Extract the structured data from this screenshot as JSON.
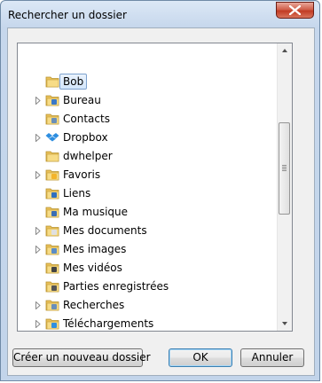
{
  "window": {
    "title": "Rechercher un dossier"
  },
  "tree": {
    "items": [
      {
        "label": "Bob",
        "expandable": false,
        "selected": true,
        "icon": "user-folder-icon"
      },
      {
        "label": "Bureau",
        "expandable": true,
        "selected": false,
        "icon": "desktop-folder-icon"
      },
      {
        "label": "Contacts",
        "expandable": false,
        "selected": false,
        "icon": "contacts-folder-icon"
      },
      {
        "label": "Dropbox",
        "expandable": true,
        "selected": false,
        "icon": "dropbox-icon"
      },
      {
        "label": "dwhelper",
        "expandable": false,
        "selected": false,
        "icon": "folder-icon"
      },
      {
        "label": "Favoris",
        "expandable": true,
        "selected": false,
        "icon": "favorites-folder-icon"
      },
      {
        "label": "Liens",
        "expandable": false,
        "selected": false,
        "icon": "links-folder-icon"
      },
      {
        "label": "Ma musique",
        "expandable": false,
        "selected": false,
        "icon": "music-folder-icon"
      },
      {
        "label": "Mes documents",
        "expandable": true,
        "selected": false,
        "icon": "documents-folder-icon"
      },
      {
        "label": "Mes images",
        "expandable": true,
        "selected": false,
        "icon": "pictures-folder-icon"
      },
      {
        "label": "Mes vidéos",
        "expandable": false,
        "selected": false,
        "icon": "videos-folder-icon"
      },
      {
        "label": "Parties enregistrées",
        "expandable": false,
        "selected": false,
        "icon": "saved-games-folder-icon"
      },
      {
        "label": "Recherches",
        "expandable": true,
        "selected": false,
        "icon": "searches-folder-icon"
      },
      {
        "label": "Téléchargements",
        "expandable": true,
        "selected": false,
        "icon": "downloads-folder-icon"
      }
    ]
  },
  "buttons": {
    "new_folder": "Créer un nouveau dossier",
    "ok": "OK",
    "cancel": "Annuler"
  }
}
